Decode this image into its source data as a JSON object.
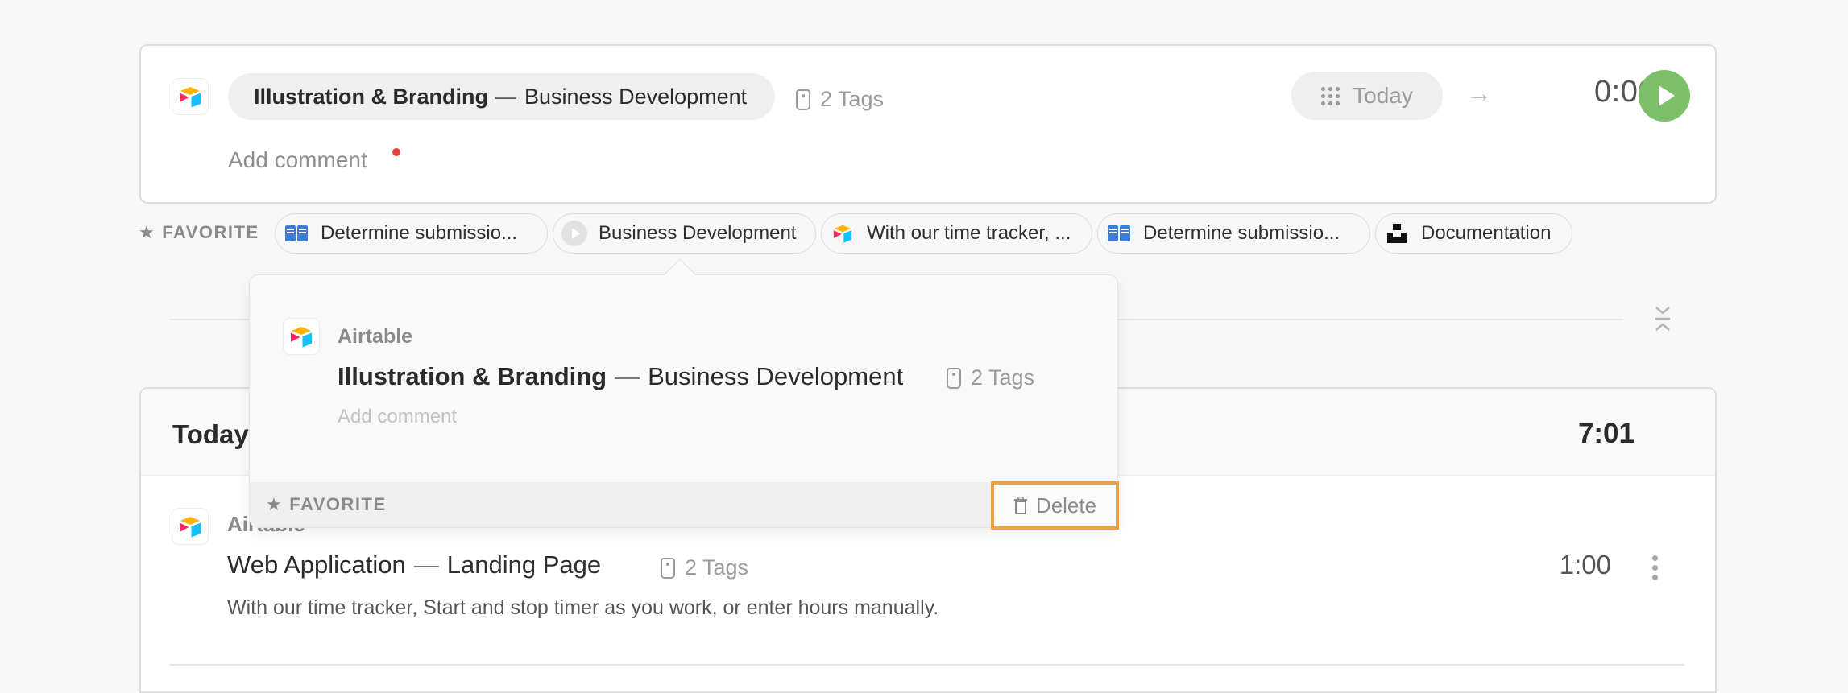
{
  "timer": {
    "project": "Illustration & Branding",
    "separator": "—",
    "task": "Business Development",
    "tags_label": "2 Tags",
    "comment_placeholder": "Add comment",
    "date_label": "Today",
    "elapsed": "0:00"
  },
  "favorites": {
    "label": "FAVORITE",
    "items": [
      {
        "label": "Determine submissio...",
        "icon": "book-icon"
      },
      {
        "label": "Business Development",
        "icon": "play-circle-icon"
      },
      {
        "label": "With our time tracker, ...",
        "icon": "airtable-icon"
      },
      {
        "label": "Determine submissio...",
        "icon": "book-icon"
      },
      {
        "label": "Documentation",
        "icon": "unsplash-icon"
      }
    ]
  },
  "popover": {
    "client": "Airtable",
    "project": "Illustration & Branding",
    "separator": "—",
    "task": "Business Development",
    "tags_label": "2 Tags",
    "comment_placeholder": "Add comment",
    "favorite_label": "FAVORITE",
    "delete_label": "Delete"
  },
  "list": {
    "header": "Today",
    "total": "7:01",
    "entries": [
      {
        "client": "Airtable",
        "project": "Web Application",
        "separator": "—",
        "task": "Landing Page",
        "tags_label": "2 Tags",
        "description": "With our time tracker, Start and stop timer as you work, or enter hours manually.",
        "duration": "1:00"
      }
    ]
  },
  "colors": {
    "accent_play": "#7cc16a",
    "highlight": "#f0a040",
    "notification_dot": "#e0443e"
  }
}
